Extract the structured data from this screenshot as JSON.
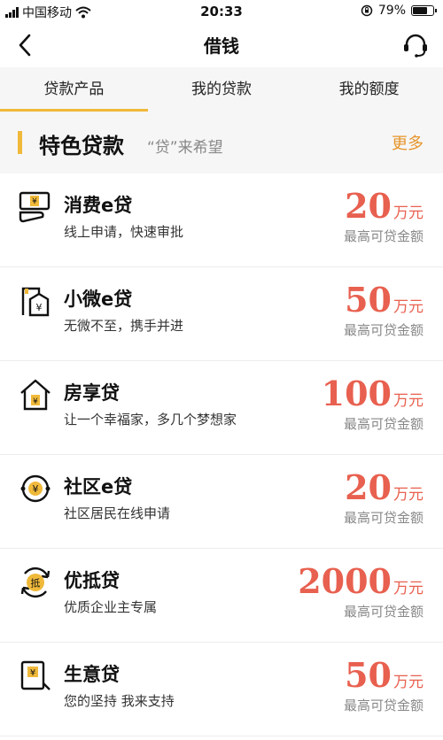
{
  "status_bar": {
    "carrier": "中国移动",
    "time": "20:33",
    "battery": "79%",
    "battery_level": 0.79
  },
  "nav": {
    "title": "借钱"
  },
  "tabs": [
    {
      "label": "贷款产品",
      "active": true
    },
    {
      "label": "我的贷款",
      "active": false
    },
    {
      "label": "我的额度",
      "active": false
    }
  ],
  "section": {
    "title": "特色贷款",
    "subtitle": "“贷”来希望",
    "more": "更多"
  },
  "products": [
    {
      "name": "消费e贷",
      "desc": "线上申请，快速审批",
      "amount": "20",
      "unit": "万元",
      "caption": "最高可贷金额",
      "icon": "consumer-loan-icon"
    },
    {
      "name": "小微e贷",
      "desc": "无微不至，携手并进",
      "amount": "50",
      "unit": "万元",
      "caption": "最高可贷金额",
      "icon": "small-business-icon"
    },
    {
      "name": "房享贷",
      "desc": "让一个幸福家，多几个梦想家",
      "amount": "100",
      "unit": "万元",
      "caption": "最高可贷金额",
      "icon": "house-icon"
    },
    {
      "name": "社区e贷",
      "desc": "社区居民在线申请",
      "amount": "20",
      "unit": "万元",
      "caption": "最高可贷金额",
      "icon": "community-icon"
    },
    {
      "name": "优抵贷",
      "desc": "优质企业主专属",
      "amount": "2000",
      "unit": "万元",
      "caption": "最高可贷金额",
      "icon": "mortgage-icon"
    },
    {
      "name": "生意贷",
      "desc": "您的坚持 我来支持",
      "amount": "50",
      "unit": "万元",
      "caption": "最高可贷金额",
      "icon": "business-icon"
    }
  ],
  "colors": {
    "accent": "#f0b93a",
    "amount": "#e8604f",
    "more": "#e6952b"
  }
}
